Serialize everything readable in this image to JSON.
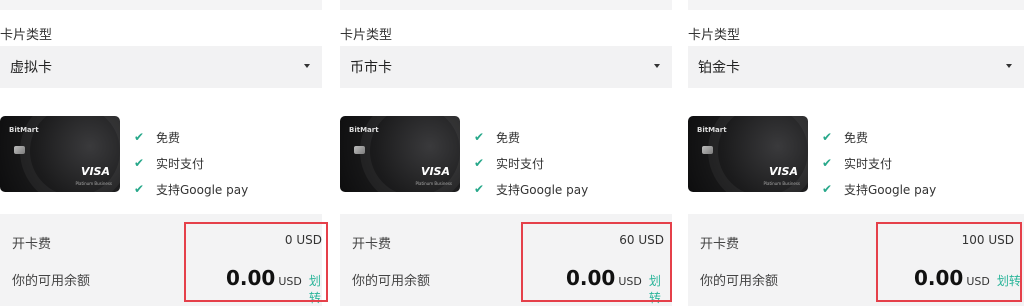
{
  "panels": [
    {
      "card_type_label": "卡片类型",
      "selected_type": "虚拟卡",
      "card": {
        "brand": "BitMart",
        "network": "VISA",
        "tier": "Platinum Business"
      },
      "features": [
        "免费",
        "实时支付",
        "支持Google pay"
      ],
      "fee_label": "开卡费",
      "fee_value": "0 USD",
      "balance_label": "你的可用余额",
      "balance_amount": "0.00",
      "balance_currency": "USD",
      "transfer_label": "划转"
    },
    {
      "card_type_label": "卡片类型",
      "selected_type": "币市卡",
      "card": {
        "brand": "BitMart",
        "network": "VISA",
        "tier": "Platinum Business"
      },
      "features": [
        "免费",
        "实时支付",
        "支持Google pay"
      ],
      "fee_label": "开卡费",
      "fee_value": "60 USD",
      "balance_label": "你的可用余额",
      "balance_amount": "0.00",
      "balance_currency": "USD",
      "transfer_label": "划转"
    },
    {
      "card_type_label": "卡片类型",
      "selected_type": "铂金卡",
      "card": {
        "brand": "BitMart",
        "network": "VISA",
        "tier": "Platinum Business"
      },
      "features": [
        "免费",
        "实时支付",
        "支持Google pay"
      ],
      "fee_label": "开卡费",
      "fee_value": "100 USD",
      "balance_label": "你的可用余额",
      "balance_amount": "0.00",
      "balance_currency": "USD",
      "transfer_label": "划转"
    }
  ],
  "colors": {
    "accent": "#2ab59a",
    "highlight_box": "#e5404a"
  },
  "icons": {
    "feature": "check-icon",
    "select": "chevron-down-icon"
  }
}
